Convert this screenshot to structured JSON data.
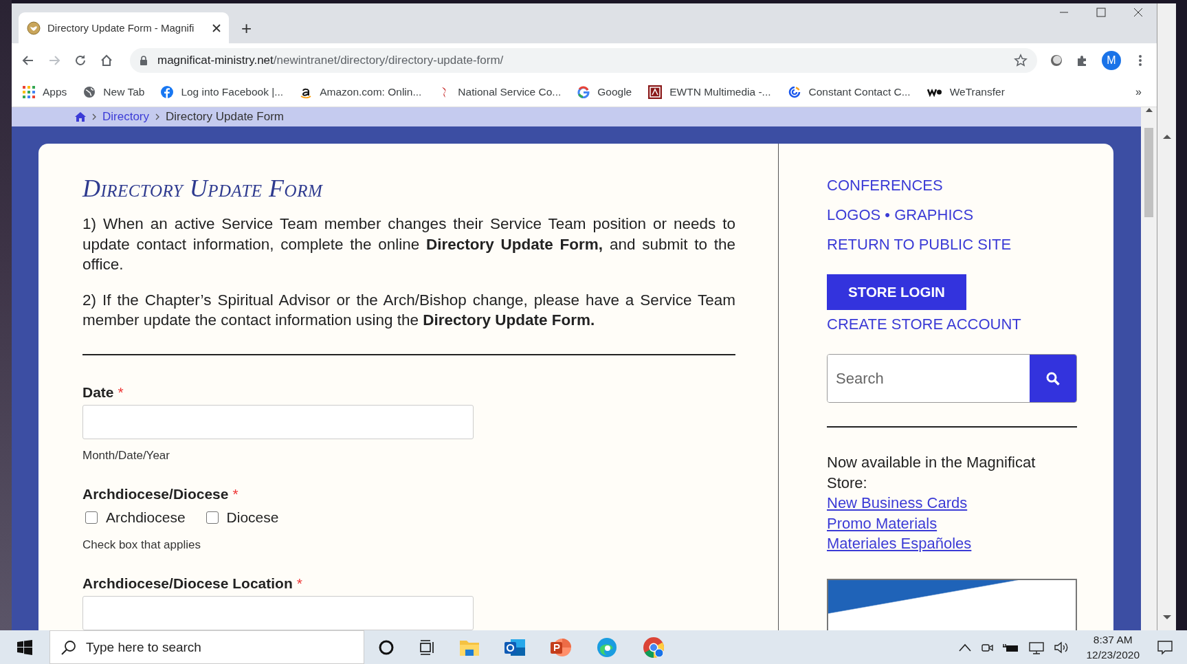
{
  "browser": {
    "tab": {
      "title": "Directory Update Form - Magnifi",
      "selected": true
    },
    "new_tab": "+",
    "url": {
      "domain": "magnificat-ministry.net",
      "path": "/newintranet/directory/directory-update-form/"
    },
    "profile_initial": "M",
    "bookmarks": [
      {
        "kind": "apps",
        "label": "Apps"
      },
      {
        "kind": "globe",
        "label": "New Tab"
      },
      {
        "kind": "facebook",
        "label": "Log into Facebook |..."
      },
      {
        "kind": "amazon",
        "label": "Amazon.com: Onlin..."
      },
      {
        "kind": "nsc",
        "label": "National Service Co..."
      },
      {
        "kind": "google",
        "label": "Google"
      },
      {
        "kind": "ewtn",
        "label": "EWTN Multimedia -..."
      },
      {
        "kind": "cc",
        "label": "Constant Contact C..."
      },
      {
        "kind": "we",
        "label": "WeTransfer"
      }
    ],
    "bookmarks_overflow": "»"
  },
  "breadcrumb": [
    {
      "label": "Directory",
      "kind": "link"
    },
    {
      "label": "Directory Update Form",
      "kind": "current"
    }
  ],
  "form": {
    "title": "Directory Update Form",
    "paragraphs": [
      "1)   When an active Service Team member changes their Service Team position or needs to update contact information, complete the online **Directory Update Form,** and submit to the office.",
      "2)  If the Chapter’s Spiritual Advisor or the Arch/Bishop change, please have a Service Team member update the contact information using the **Directory Update Form.**"
    ],
    "fields": [
      {
        "kind": "text",
        "label": "Date",
        "required_mark": "*",
        "hint": "Month/Date/Year"
      },
      {
        "kind": "checkboxes",
        "label": "Archdiocese/Diocese",
        "required_mark": "*",
        "options": [
          {
            "label": "Archdiocese",
            "checked": false
          },
          {
            "label": "Diocese",
            "checked": false
          }
        ],
        "hint": "Check box that applies"
      },
      {
        "kind": "text",
        "label": "Archdiocese/Diocese Location",
        "required_mark": "*"
      }
    ]
  },
  "sidebar": {
    "links": [
      "CONFERENCES",
      "LOGOS • GRAPHICS",
      "RETURN TO PUBLIC SITE"
    ],
    "store_login": "STORE LOGIN",
    "create_account": "CREATE STORE ACCOUNT",
    "search": {
      "placeholder": "Search"
    },
    "promo_text": "Now available in the Magnificat Store:",
    "promo_links": [
      "New Business Cards",
      "Promo Materials",
      "Materiales Españoles"
    ]
  },
  "taskbar": {
    "search": {
      "placeholder": "Type here to search"
    },
    "time": "8:37 AM",
    "date": "12/23/2020"
  }
}
